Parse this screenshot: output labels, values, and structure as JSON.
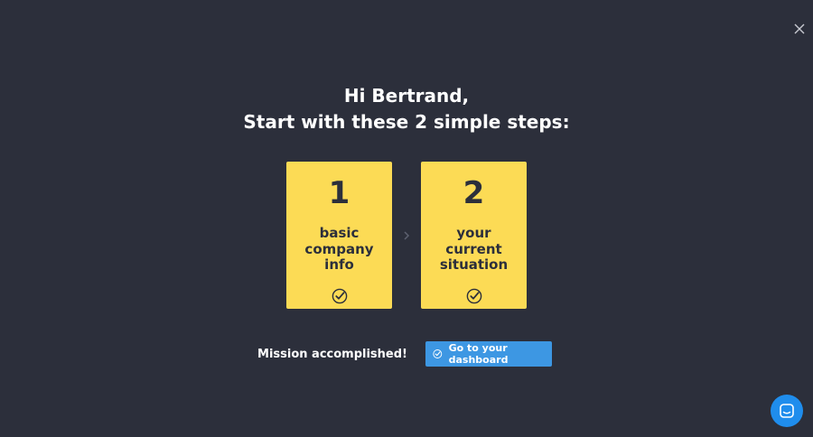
{
  "header": {
    "greeting": "Hi Bertrand,",
    "subtitle": "Start with these 2 simple steps:"
  },
  "steps": [
    {
      "number": "1",
      "label_lines": [
        "basic",
        "company",
        "info"
      ],
      "completed": true
    },
    {
      "number": "2",
      "label_lines": [
        "your",
        "current",
        "situation"
      ],
      "completed": true
    }
  ],
  "footer": {
    "status_text": "Mission accomplished!",
    "dashboard_button_label": "Go to your dashboard"
  },
  "icons": {
    "close": "close-icon",
    "check": "check-circle-icon",
    "arrow": "chevron-right-icon",
    "chat": "chat-icon"
  },
  "colors": {
    "background": "#2c2f3b",
    "card": "#fcdb55",
    "button": "#3d97e3",
    "chat": "#1f8ded"
  }
}
